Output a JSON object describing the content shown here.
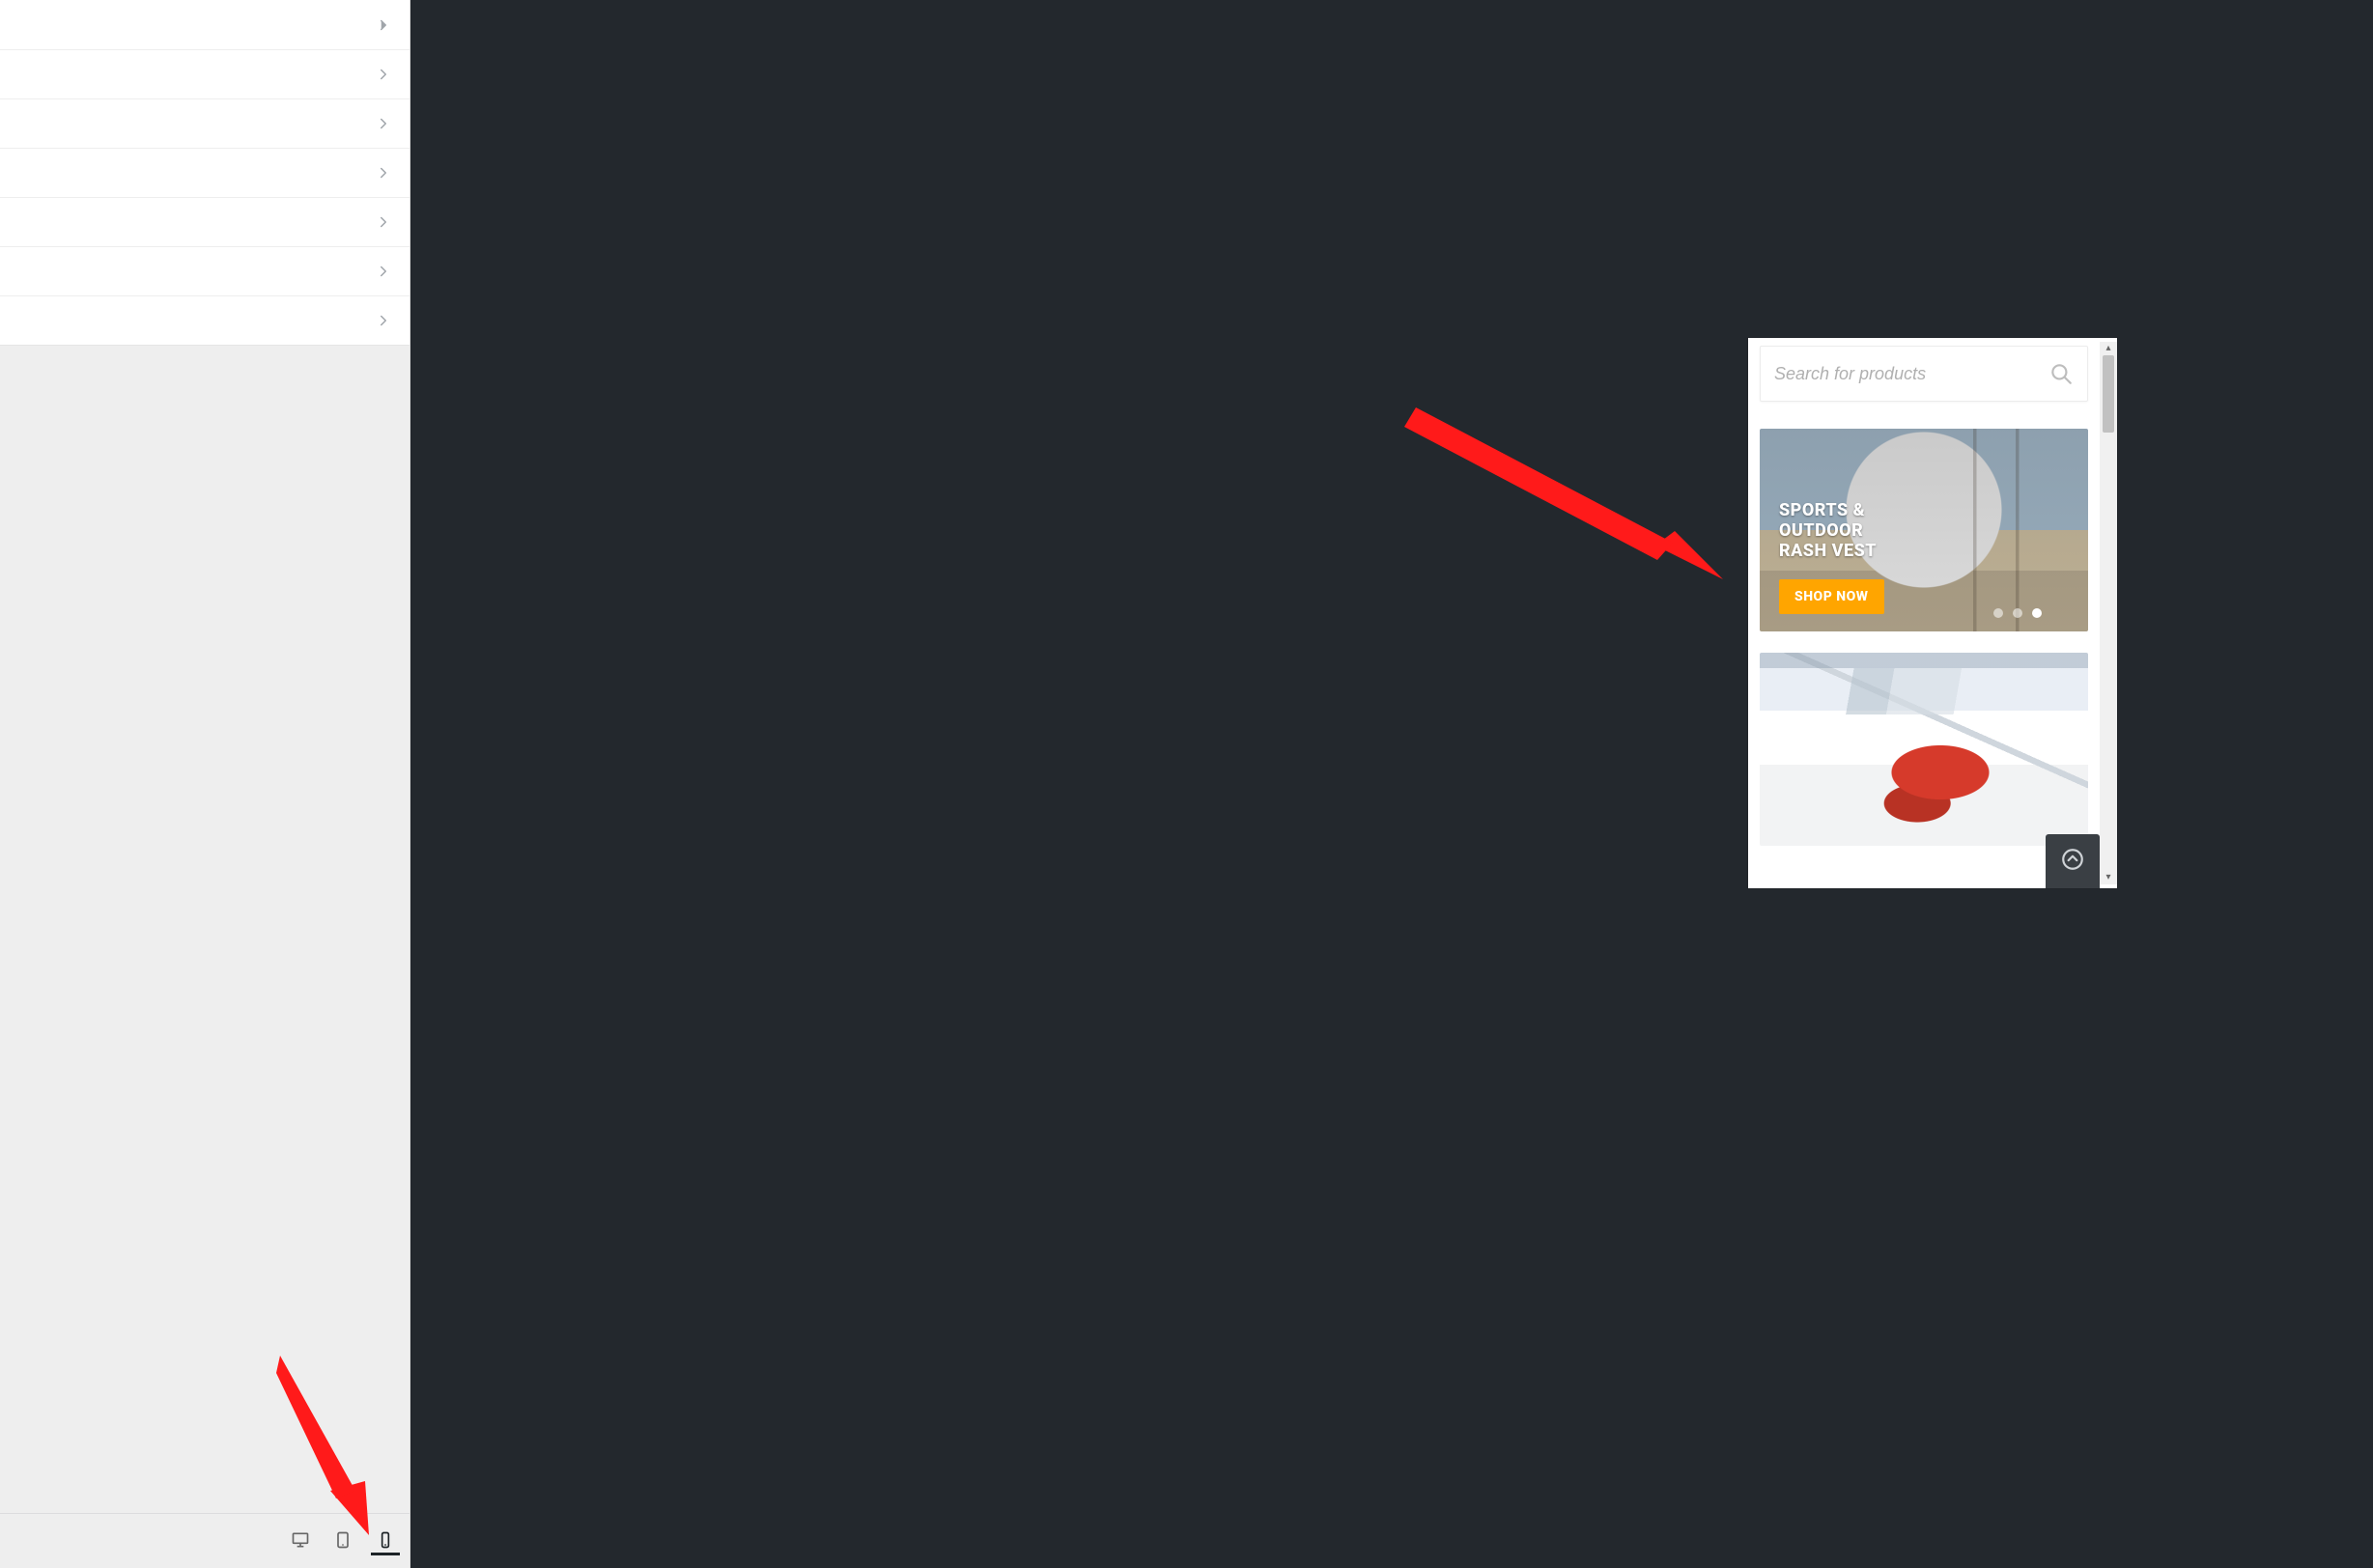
{
  "sidebar": {
    "items": [
      {
        "label": ""
      },
      {
        "label": ""
      },
      {
        "label": ""
      },
      {
        "label": ""
      },
      {
        "label": ""
      },
      {
        "label": ""
      },
      {
        "label": ""
      }
    ]
  },
  "devices": {
    "desktop": "Desktop",
    "tablet": "Tablet",
    "mobile": "Mobile",
    "active": "mobile"
  },
  "preview": {
    "search": {
      "placeholder": "Search for products"
    },
    "hero": {
      "line1": "SPORTS &",
      "line2": "OUTDOOR",
      "line3": "RASH VEST",
      "sub": "",
      "cta": "SHOP NOW",
      "dots": 3,
      "active_dot": 2
    },
    "back_to_top_title": "Back to top"
  },
  "colors": {
    "canvas": "#23282d",
    "cta": "#ffa500",
    "arrow": "#ff1a1a"
  }
}
